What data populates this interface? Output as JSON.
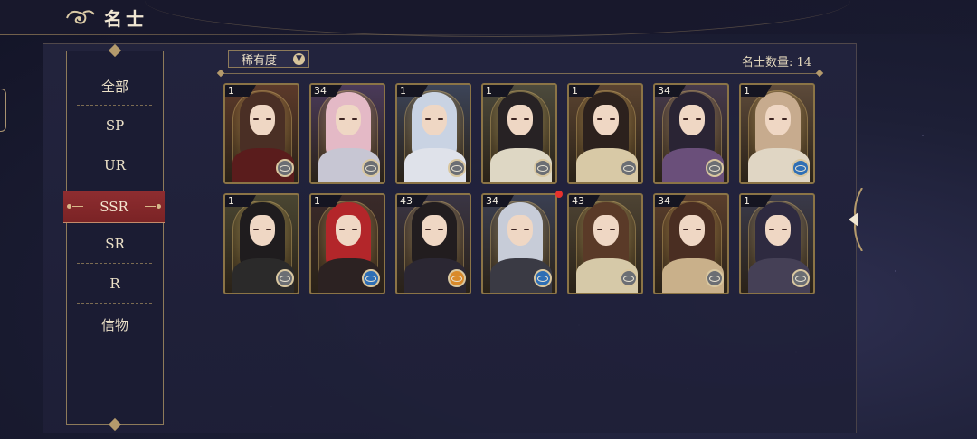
{
  "header": {
    "title": "名士",
    "logo_icon": "cloud-swirl-icon"
  },
  "sidebar": {
    "items": [
      {
        "label": "全部"
      },
      {
        "label": "SP"
      },
      {
        "label": "UR"
      },
      {
        "label": "SSR",
        "active": true
      },
      {
        "label": "SR"
      },
      {
        "label": "R"
      },
      {
        "label": "信物"
      }
    ]
  },
  "filter": {
    "label": "稀有度",
    "icon": "chevron-down-icon"
  },
  "count": {
    "text": "名士数量: 14"
  },
  "cards": [
    {
      "level": "1",
      "badge": "gray",
      "hair": "#4a2f25",
      "bg": "#5c3a2a",
      "outfit": "#5a1c1c"
    },
    {
      "level": "34",
      "badge": "gray",
      "hair": "#e4b9c6",
      "bg": "#4a3a5a",
      "outfit": "#c7c6d3"
    },
    {
      "level": "1",
      "badge": "gray",
      "hair": "#c9d3e3",
      "bg": "#3c4458",
      "outfit": "#dfe2ea"
    },
    {
      "level": "1",
      "badge": "gray",
      "hair": "#272224",
      "bg": "#4c4a3c",
      "outfit": "#ded7c4"
    },
    {
      "level": "1",
      "badge": "gray",
      "hair": "#2c211d",
      "bg": "#5a4330",
      "outfit": "#d8c9a6"
    },
    {
      "level": "34",
      "badge": "gray",
      "hair": "#2a2434",
      "bg": "#463a4c",
      "outfit": "#6a4f7a"
    },
    {
      "level": "1",
      "badge": "blue",
      "hair": "#c7ab8e",
      "bg": "#5d4a3a",
      "outfit": "#e0d6c4"
    },
    {
      "level": "1",
      "badge": "gray",
      "hair": "#1f1c1e",
      "bg": "#4a4632",
      "outfit": "#2b2a2a"
    },
    {
      "level": "1",
      "badge": "blue",
      "hair": "#b3262a",
      "bg": "#3a2a2a",
      "outfit": "#2c2222"
    },
    {
      "level": "43",
      "badge": "orange",
      "hair": "#221d1f",
      "bg": "#3a3544",
      "outfit": "#2b2733"
    },
    {
      "level": "34",
      "badge": "blue",
      "hair": "#c7ccd8",
      "bg": "#3a3f52",
      "outfit": "#3a3a44"
    },
    {
      "level": "43",
      "badge": "gray",
      "hair": "#5a3a28",
      "bg": "#4e4434",
      "outfit": "#d6c9a8"
    },
    {
      "level": "34",
      "badge": "gray",
      "hair": "#4a2e22",
      "bg": "#5a3e2c",
      "outfit": "#c9b08a"
    },
    {
      "level": "1",
      "badge": "gray",
      "hair": "#2e2a40",
      "bg": "#3a3a4a",
      "outfit": "#454056"
    }
  ],
  "colors": {
    "badge_gray": "#6b6e74",
    "badge_blue": "#2f6fb5",
    "badge_orange": "#d98a2b",
    "accent_red": "#8e2d30",
    "gold": "#b49a6c"
  }
}
